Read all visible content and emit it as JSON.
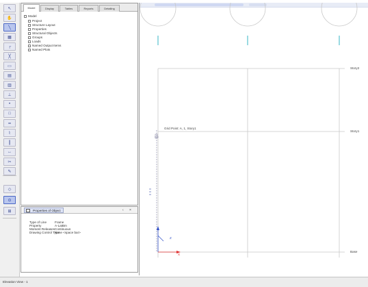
{
  "toolbar": {
    "buttons": [
      {
        "icon": "pointer-icon",
        "glyph": "↖",
        "highlight": false
      },
      {
        "icon": "zoom-icon",
        "glyph": "✋",
        "highlight": false
      },
      {
        "icon": "draw-line-icon",
        "glyph": "╲",
        "highlight": true
      },
      {
        "icon": "grid-icon",
        "glyph": "▦",
        "highlight": false
      },
      {
        "icon": "frame-icon",
        "glyph": "┌",
        "highlight": false
      },
      {
        "icon": "brace-icon",
        "glyph": "╳",
        "highlight": false
      },
      {
        "icon": "area-icon",
        "glyph": "▭",
        "highlight": false
      },
      {
        "icon": "slab-icon",
        "glyph": "▤",
        "highlight": false
      },
      {
        "icon": "wall-icon",
        "glyph": "▥",
        "highlight": false
      },
      {
        "icon": "support-icon",
        "glyph": "⊥",
        "highlight": false
      },
      {
        "icon": "joint-icon",
        "glyph": "•",
        "highlight": false
      },
      {
        "icon": "opening-icon",
        "glyph": "□",
        "highlight": false
      },
      {
        "icon": "beam-icon",
        "glyph": "━",
        "highlight": false
      },
      {
        "icon": "link-icon",
        "glyph": "⌇",
        "highlight": false
      },
      {
        "icon": "column-icon",
        "glyph": "┃",
        "highlight": false
      },
      {
        "icon": "measure-icon",
        "glyph": "↔",
        "highlight": false
      },
      {
        "icon": "section-cut-icon",
        "glyph": "✂",
        "highlight": false
      },
      {
        "icon": "pencil-icon",
        "glyph": "✎",
        "highlight": false
      },
      {
        "icon": "assign-icon",
        "glyph": "◇",
        "highlight": false
      },
      {
        "icon": "snap-icon",
        "glyph": "⊙",
        "highlight": true
      },
      {
        "icon": "quick-draw-icon",
        "glyph": "⊞",
        "highlight": false
      }
    ]
  },
  "explorer": {
    "tabs": [
      {
        "label": "Model",
        "active": true
      },
      {
        "label": "Display",
        "active": false
      },
      {
        "label": "Tables",
        "active": false
      },
      {
        "label": "Reports",
        "active": false
      },
      {
        "label": "Detailing",
        "active": false
      }
    ],
    "tree": {
      "root": "Model",
      "children": [
        "Project",
        "Structure Layout",
        "Properties",
        "Structural Objects",
        "Groups",
        "Loads",
        "Named Output Items",
        "Named Plots"
      ]
    }
  },
  "properties": {
    "title": "Properties of Object",
    "pin_glyph": "‹",
    "close_glyph": "×",
    "rows": [
      {
        "key": "Type of Line",
        "value": "Frame"
      },
      {
        "key": "Property",
        "value": "A-LatBm"
      },
      {
        "key": "Moment Releases",
        "value": "Continuous"
      },
      {
        "key": "Drawing Control Type",
        "value": "None <space bar>"
      }
    ]
  },
  "status": {
    "text": "Elevation View - 1"
  },
  "viewport": {
    "stories": [
      "Story2",
      "Story1",
      "Base"
    ],
    "tooltip": "Grid Point: A, 1, Story1",
    "axis_x": "X",
    "axis_z": "Z"
  },
  "colors": {
    "grid_line": "#c8c8c8",
    "grid_marker": "#36b4c4",
    "axis_red": "#e03030",
    "axis_blue": "#3050c8",
    "accent": "#4a66c4"
  }
}
